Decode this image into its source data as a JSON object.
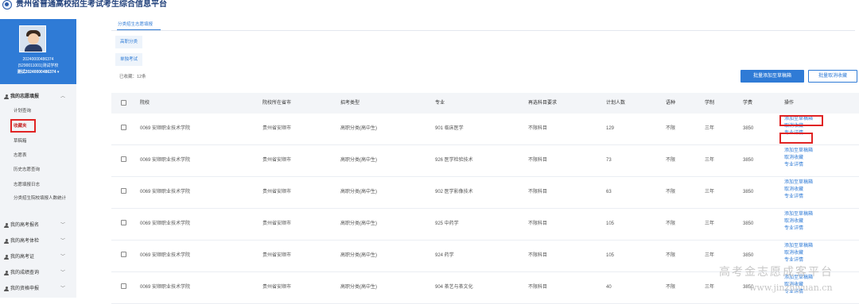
{
  "app": {
    "title": "贵州省普通高校招生考试考生综合信息平台"
  },
  "profile": {
    "id": "20240000486374",
    "school": "(5290011001)测试学校",
    "user": "测试20240000486374 ▾"
  },
  "sidebar": {
    "section_main": "我的志愿填报",
    "sub_items": [
      "计划查询",
      "收藏夹",
      "草稿箱",
      "志愿表",
      "历史志愿查询",
      "志愿填报日志",
      "分类招生院校填报人数统计"
    ],
    "active_index": 1,
    "other_sections": [
      "我的高考报名",
      "我的高考体检",
      "我的高考证",
      "我的成绩查询",
      "我的资格申报"
    ]
  },
  "tabs": {
    "active": "分类招生志愿填报"
  },
  "filters": {
    "chip1": "高职分类",
    "chip2": "单独考试"
  },
  "summary": {
    "count_text": "已收藏：12条"
  },
  "buttons": {
    "batch_add": "批量添加至草稿箱",
    "batch_remove": "批量取消收藏"
  },
  "table": {
    "headers": [
      "院校",
      "院校所在省市",
      "招考类型",
      "专业",
      "再选科目要求",
      "计划人数",
      "语种",
      "学制",
      "学费",
      "操作"
    ],
    "rows": [
      {
        "school": "0069 安顺职业技术学院",
        "city": "贵州省安顺市",
        "type": "高职分类(高中生)",
        "major": "901 临床医学",
        "req": "不限科目",
        "plan": "129",
        "lang": "不限",
        "years": "三年",
        "fee": "3850"
      },
      {
        "school": "0069 安顺职业技术学院",
        "city": "贵州省安顺市",
        "type": "高职分类(高中生)",
        "major": "926 医学检验技术",
        "req": "不限科目",
        "plan": "73",
        "lang": "不限",
        "years": "三年",
        "fee": "3850"
      },
      {
        "school": "0069 安顺职业技术学院",
        "city": "贵州省安顺市",
        "type": "高职分类(高中生)",
        "major": "902 医学影像技术",
        "req": "不限科目",
        "plan": "63",
        "lang": "不限",
        "years": "三年",
        "fee": "3850"
      },
      {
        "school": "0069 安顺职业技术学院",
        "city": "贵州省安顺市",
        "type": "高职分类(高中生)",
        "major": "925 中药学",
        "req": "不限科目",
        "plan": "105",
        "lang": "不限",
        "years": "三年",
        "fee": "3850"
      },
      {
        "school": "0069 安顺职业技术学院",
        "city": "贵州省安顺市",
        "type": "高职分类(高中生)",
        "major": "924 药学",
        "req": "不限科目",
        "plan": "105",
        "lang": "不限",
        "years": "三年",
        "fee": "3850"
      },
      {
        "school": "0069 安顺职业技术学院",
        "city": "贵州省安顺市",
        "type": "高职分类(高中生)",
        "major": "904 茶艺与茶文化",
        "req": "不限科目",
        "plan": "40",
        "lang": "不限",
        "years": "三年",
        "fee": "3850"
      }
    ],
    "ops": {
      "add": "添加至草稿箱",
      "remove": "取消收藏",
      "detail": "专业详情"
    }
  },
  "watermark": {
    "line1": "高考金志愿成客平台",
    "line2": "www.jinzhiyuan.cn"
  },
  "colors": {
    "accent": "#2f7bd6",
    "highlight": "#e02424"
  }
}
